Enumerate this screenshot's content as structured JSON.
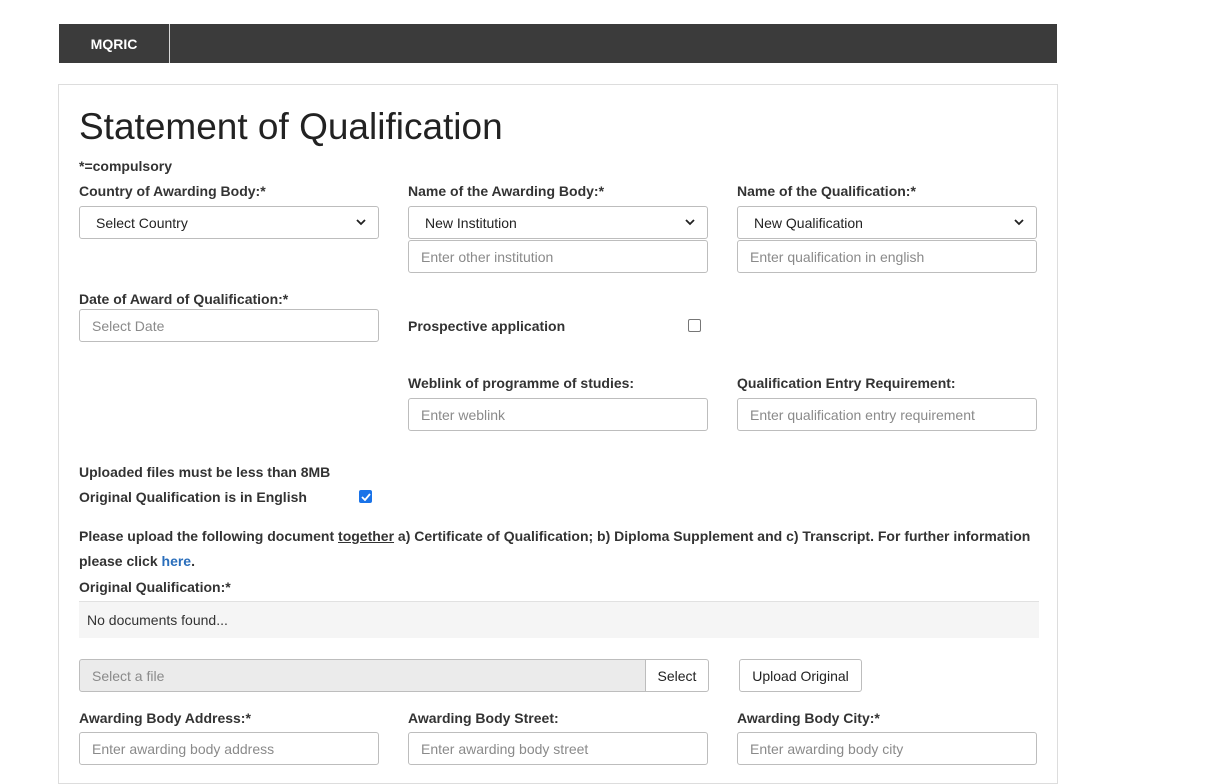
{
  "nav": {
    "brand": "MQRIC"
  },
  "page": {
    "title": "Statement of Qualification",
    "compulsory_note": "*=compulsory"
  },
  "form": {
    "country_label": "Country of Awarding Body:*",
    "country_value": "Select Country",
    "awarding_body_label": "Name of the Awarding Body:*",
    "awarding_body_value": "New Institution",
    "other_institution_placeholder": "Enter other institution",
    "qualification_label": "Name of the Qualification:*",
    "qualification_value": "New Qualification",
    "qualification_english_placeholder": "Enter qualification in english",
    "date_label": "Date of Award of Qualification:*",
    "date_placeholder": "Select Date",
    "prospective_label": "Prospective application",
    "prospective_checked": false,
    "weblink_label": "Weblink of programme of studies:",
    "weblink_placeholder": "Enter weblink",
    "entry_req_label": "Qualification Entry Requirement:",
    "entry_req_placeholder": "Enter qualification entry requirement",
    "upload_size_note": "Uploaded files must be less than 8MB",
    "english_label": "Original Qualification is in English",
    "english_checked": true,
    "upload_info_pre": "Please upload the following document ",
    "upload_info_underlined": "together",
    "upload_info_post": " a) Certificate of Qualification; b) Diploma Supplement and c) Transcript. For further information please click ",
    "upload_info_link": "here",
    "upload_info_end": ".",
    "original_label": "Original Qualification:*",
    "no_documents": "No documents found...",
    "file_placeholder": "Select a file",
    "select_button": "Select",
    "upload_button": "Upload Original",
    "address_label": "Awarding Body Address:*",
    "address_placeholder": "Enter awarding body address",
    "street_label": "Awarding Body Street:",
    "street_placeholder": "Enter awarding body street",
    "city_label": "Awarding Body City:*",
    "city_placeholder": "Enter awarding body city"
  },
  "icons": {
    "select_chevron": "chevron-down-icon",
    "checkmark": "check-icon"
  },
  "colors": {
    "navbar": "#3b3b3b",
    "link": "#2a6ebb",
    "checkbox_checked": "#1a73e8"
  }
}
